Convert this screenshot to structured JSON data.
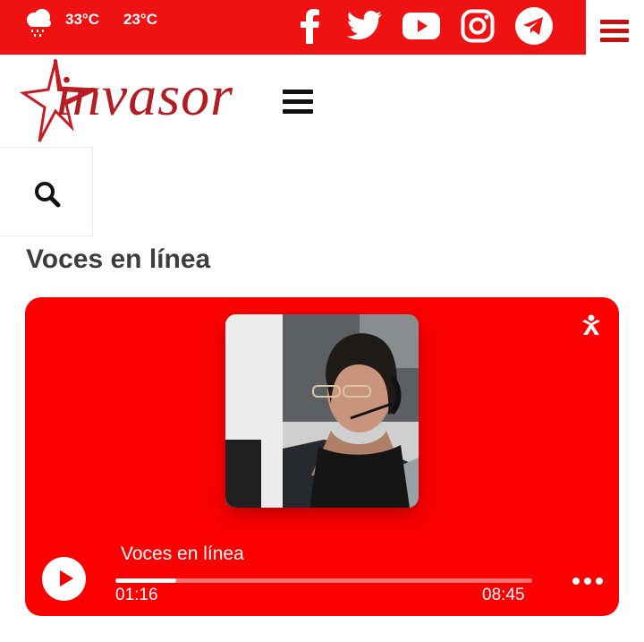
{
  "weather": {
    "icon": "cloud-rain-icon",
    "high": "33°C",
    "low": "23°C"
  },
  "social": [
    "facebook-icon",
    "twitter-icon",
    "youtube-icon",
    "instagram-icon",
    "telegram-icon"
  ],
  "logo": {
    "text": "invasor",
    "color": "#b21d23"
  },
  "colors": {
    "brand_red": "#ee1212",
    "player_red": "#fb0000"
  },
  "page": {
    "title": "Voces en línea"
  },
  "player": {
    "title": "Voces en línea",
    "current_time": "01:16",
    "duration": "08:45",
    "progress": 0.145
  }
}
